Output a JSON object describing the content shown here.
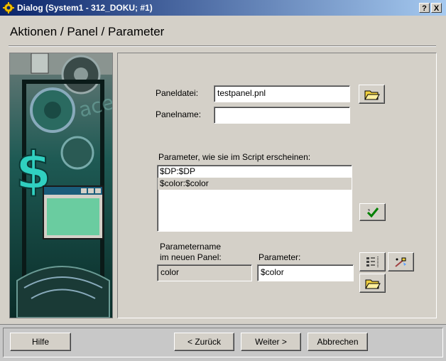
{
  "window": {
    "title": "Dialog (System1 - 312_DOKU; #1)",
    "help_btn": "?",
    "close_btn": "X"
  },
  "page_title": "Aktionen / Panel / Parameter",
  "form": {
    "paneldatei_label": "Paneldatei:",
    "paneldatei_value": "testpanel.pnl",
    "panelname_label": "Panelname:",
    "panelname_value": "",
    "parameter_list_label": "Parameter, wie sie im Script erscheinen:",
    "parameter_list": [
      {
        "text": "$DP:$DP",
        "selected": false
      },
      {
        "text": "$color:$color",
        "selected": true
      }
    ],
    "paramname_label_line1": "Parametername",
    "paramname_label_line2": "im neuen Panel:",
    "paramname_value": "color",
    "parameter_label": "Parameter:",
    "parameter_value": "$color"
  },
  "footer": {
    "hilfe": "Hilfe",
    "zurueck": "< Zurück",
    "weiter": "Weiter >",
    "abbrechen": "Abbrechen"
  },
  "colors": {
    "title_gradient_start": "#0a246a",
    "title_gradient_end": "#a6caf0",
    "dialog_bg": "#d4d0c8",
    "image_teal": "#0c3a36",
    "checkmark_green": "#008000",
    "folder_yellow": "#f0d040"
  }
}
